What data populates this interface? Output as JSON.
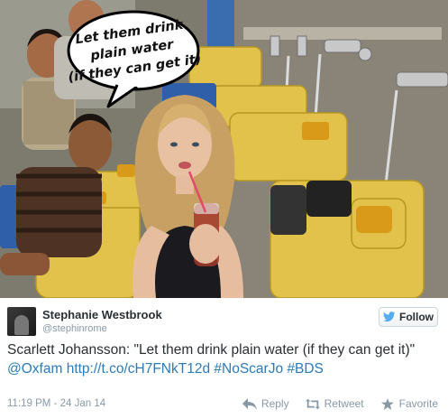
{
  "photo": {
    "speech_bubble_lines": [
      "Let them drink",
      "plain water",
      "(if they can get it)"
    ]
  },
  "tweet": {
    "display_name": "Stephanie Westbrook",
    "screen_name": "@stephinrome",
    "follow_label": "Follow",
    "text_plain": "Scarlett Johansson: \"Let them drink plain water (if they can get it)\"",
    "mention": "@Oxfam",
    "link": "http://t.co/cH7FNkT12d",
    "hashtag1": "#NoScarJo",
    "hashtag2": "#BDS",
    "timestamp": "11:19 PM - 24 Jan 14",
    "reply_label": "Reply",
    "retweet_label": "Retweet",
    "favorite_label": "Favorite"
  },
  "colors": {
    "link": "#2b7bb9",
    "follow_icon": "#55acee",
    "muted": "#8899a6"
  }
}
